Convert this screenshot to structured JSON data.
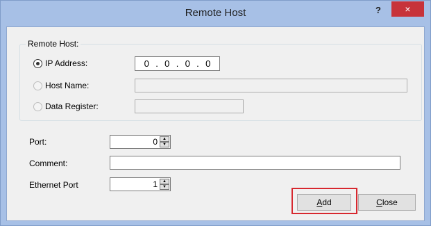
{
  "window": {
    "title": "Remote Host",
    "help_label": "?",
    "close_label": "×"
  },
  "remote_host": {
    "legend": "Remote Host:",
    "options": [
      {
        "label": "IP Address:",
        "selected": true
      },
      {
        "label": "Host Name:",
        "selected": false
      },
      {
        "label": "Data Register:",
        "selected": false
      }
    ],
    "ip_octets": [
      "0",
      ".",
      "0",
      ".",
      "0",
      ".",
      "0"
    ]
  },
  "port": {
    "label": "Port:",
    "value": "0"
  },
  "comment": {
    "label": "Comment:",
    "value": ""
  },
  "ethernet_port": {
    "label": "Ethernet Port",
    "value": "1"
  },
  "buttons": {
    "add_mnemonic": "A",
    "add_rest": "dd",
    "close_mnemonic": "C",
    "close_rest": "lose"
  },
  "colors": {
    "titlebar": "#a7c0e6",
    "close_button": "#c7333a",
    "highlight": "#d7282f"
  }
}
